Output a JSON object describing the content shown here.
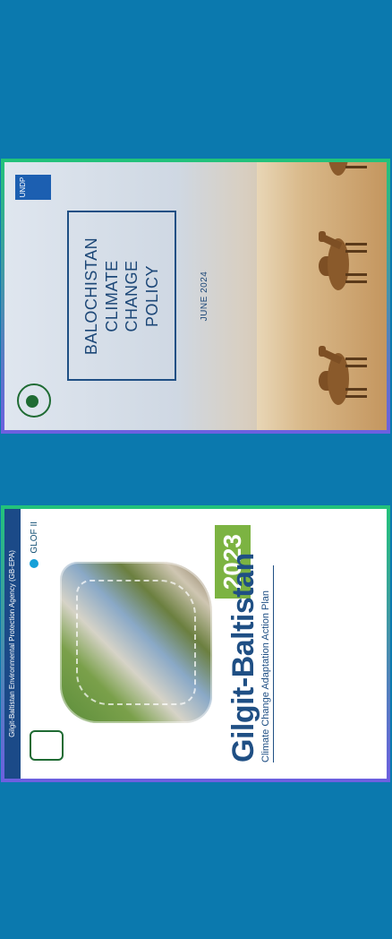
{
  "background_color": "#0b79ae",
  "frame_border_gradient": [
    "#22c37a",
    "#6d5fe0"
  ],
  "covers": [
    {
      "id": "balochistan",
      "title_lines": [
        "BALOCHISTAN",
        "CLIMATE CHANGE",
        "POLICY"
      ],
      "date": "JUNE 2024",
      "logo_left": "govt-balochistan-seal-icon",
      "logo_right": "undp-logo-icon",
      "image": "camels-desert"
    },
    {
      "id": "gilgit-baltistan",
      "agency": "Gilgit-Baltistan Environmental Protection Agency (GB-EPA)",
      "title": "Gilgit-Baltistan",
      "subtitle": "Climate Change Adaptation Action Plan",
      "year": "2023",
      "glof_label": "GLOF II",
      "logo_left": "government-emblem-icon",
      "logo_right": "glof-ii-logo-icon",
      "image": "gilgit-baltistan-map-collage"
    }
  ]
}
